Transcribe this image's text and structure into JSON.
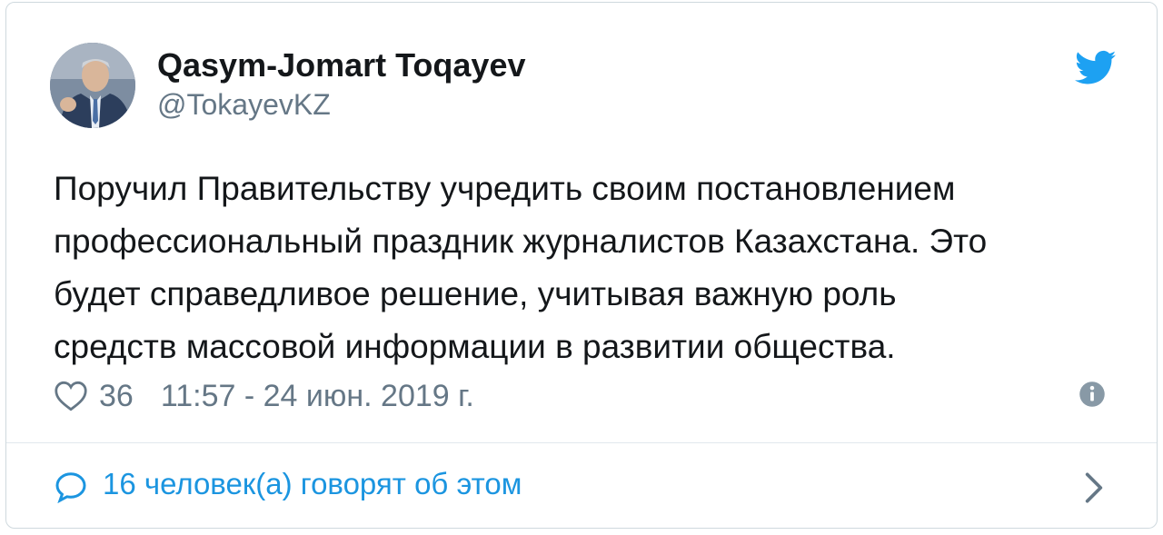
{
  "author": {
    "name": "Qasym-Jomart Toqayev",
    "handle": "@TokayevKZ",
    "avatar_icon": "profile-photo"
  },
  "brand": {
    "icon": "twitter-bird-icon",
    "color": "#1da1f2"
  },
  "tweet": {
    "lines": [
      "Поручил Правительству учредить своим постановлением",
      "профессиональный праздник журналистов Казахстана. Это",
      "будет справедливое решение, учитывая важную роль",
      "средств массовой информации в развитии общества."
    ],
    "likes": "36",
    "timestamp": "11:57 - 24 июн. 2019 г.",
    "like_icon": "heart-icon",
    "info_icon": "info-icon"
  },
  "footer": {
    "label": "16 человек(а) говорят об этом",
    "icon": "speech-bubble-icon",
    "chevron_icon": "chevron-right-icon",
    "link_color": "#1b95e0"
  }
}
